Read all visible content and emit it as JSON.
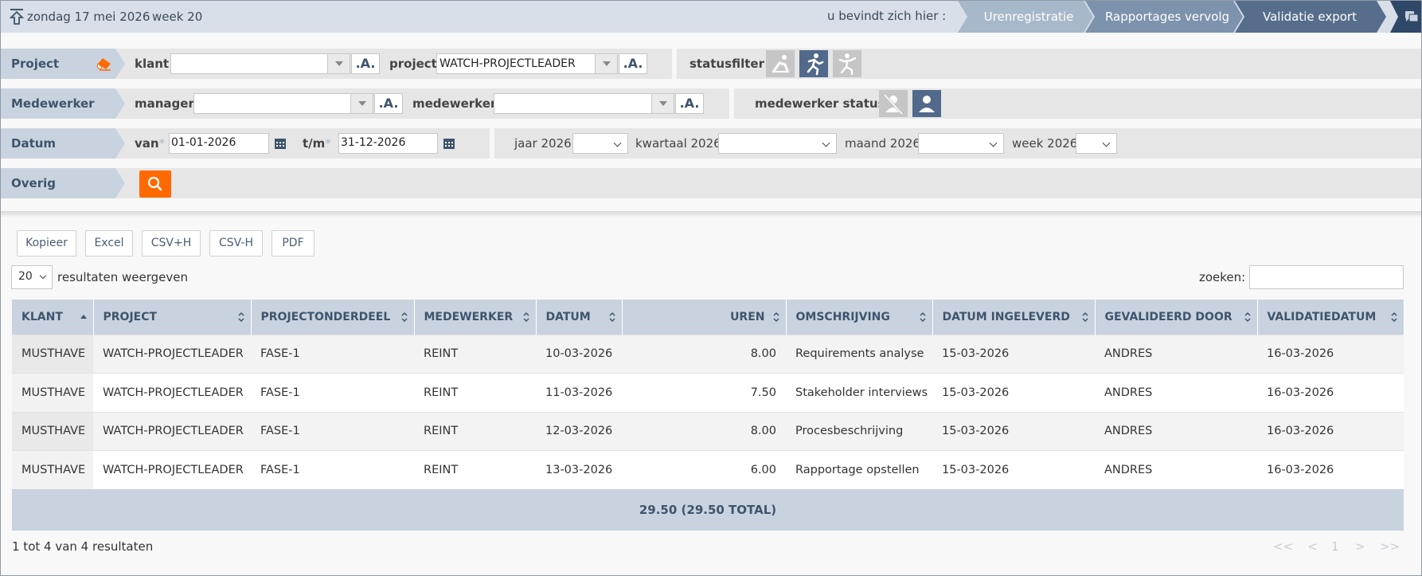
{
  "topbar": {
    "date": "zondag 17 mei 2026",
    "week": "week 20",
    "here_label": "u bevindt zich hier :",
    "breadcrumbs": [
      "Urenregistratie",
      "Rapportages vervolg",
      "Validatie export"
    ]
  },
  "filters": {
    "project": {
      "head": "Project",
      "klant_label": "klant",
      "klant_value": "",
      "project_label": "project",
      "project_value": "WATCH-PROJECTLEADER",
      "a_label": ".A.",
      "statusfilter_label": "statusfilter"
    },
    "medewerker": {
      "head": "Medewerker",
      "manager_label": "manager",
      "manager_value": "",
      "medewerker_label": "medewerker",
      "medewerker_value": "",
      "status_label": "medewerker status"
    },
    "datum": {
      "head": "Datum",
      "van_label": "van",
      "van_value": "01-01-2026",
      "tm_label": "t/m",
      "tm_value": "31-12-2026",
      "star": "*",
      "jaar_label": "jaar 2026",
      "kwartaal_label": "kwartaal 2026",
      "maand_label": "maand 2026",
      "week_label": "week 2026"
    },
    "overig": {
      "head": "Overig"
    }
  },
  "buttons": [
    "Kopieer",
    "Excel",
    "CSV+H",
    "CSV-H",
    "PDF"
  ],
  "length": {
    "value": "20",
    "label": "resultaten weergeven"
  },
  "search": {
    "label": "zoeken:",
    "value": ""
  },
  "table": {
    "headers": [
      "KLANT",
      "PROJECT",
      "PROJECTONDERDEEL",
      "MEDEWERKER",
      "DATUM",
      "UREN",
      "OMSCHRIJVING",
      "DATUM INGELEVERD",
      "GEVALIDEERD DOOR",
      "VALIDATIEDATUM"
    ],
    "rows": [
      [
        "MUSTHAVE",
        "WATCH-PROJECTLEADER",
        "FASE-1",
        "REINT",
        "10-03-2026",
        "8.00",
        "Requirements analyse",
        "15-03-2026",
        "ANDRES",
        "16-03-2026"
      ],
      [
        "MUSTHAVE",
        "WATCH-PROJECTLEADER",
        "FASE-1",
        "REINT",
        "11-03-2026",
        "7.50",
        "Stakeholder interviews",
        "15-03-2026",
        "ANDRES",
        "16-03-2026"
      ],
      [
        "MUSTHAVE",
        "WATCH-PROJECTLEADER",
        "FASE-1",
        "REINT",
        "12-03-2026",
        "8.00",
        "Procesbeschrijving",
        "15-03-2026",
        "ANDRES",
        "16-03-2026"
      ],
      [
        "MUSTHAVE",
        "WATCH-PROJECTLEADER",
        "FASE-1",
        "REINT",
        "13-03-2026",
        "6.00",
        "Rapportage opstellen",
        "15-03-2026",
        "ANDRES",
        "16-03-2026"
      ]
    ],
    "total": "29.50 (29.50 TOTAL)"
  },
  "info": "1 tot 4 van 4 resultaten",
  "pager": {
    "first": "<<",
    "prev": "<",
    "page": "1",
    "next": ">",
    "last": ">>"
  },
  "colors": {
    "accent": "#ff6a00",
    "header_blue": "#3e546d",
    "table_head": "#c9d3df",
    "active_status": "#51698a"
  }
}
